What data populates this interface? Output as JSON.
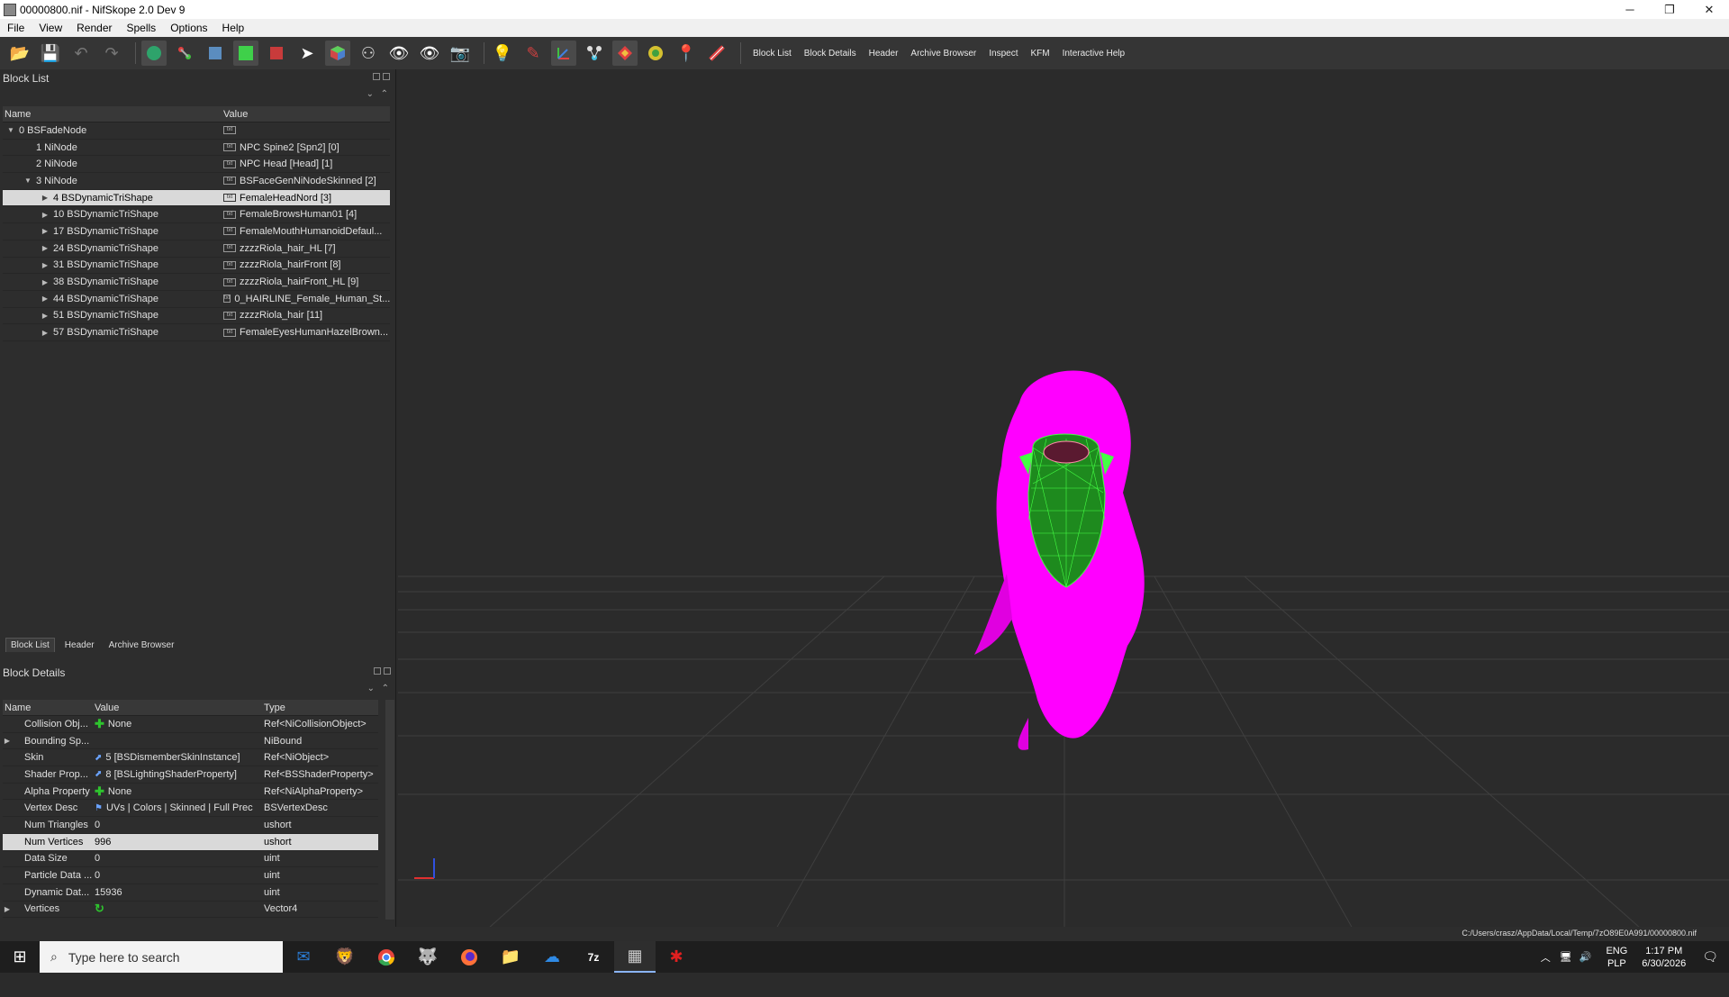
{
  "window": {
    "title": "00000800.nif - NifSkope 2.0 Dev 9"
  },
  "menu": {
    "items": [
      "File",
      "View",
      "Render",
      "Spells",
      "Options",
      "Help"
    ]
  },
  "toolbar": {
    "text_buttons": [
      "Block List",
      "Block Details",
      "Header",
      "Archive Browser",
      "Inspect",
      "KFM",
      "Interactive Help"
    ]
  },
  "block_list": {
    "title": "Block List",
    "columns": [
      "Name",
      "Value"
    ],
    "rows": [
      {
        "name": "0 BSFadeNode",
        "value": "",
        "indent": 0,
        "arrow": "▼"
      },
      {
        "name": "1 NiNode",
        "value": "NPC Spine2 [Spn2] [0]",
        "indent": 1,
        "arrow": ""
      },
      {
        "name": "2 NiNode",
        "value": "NPC Head [Head] [1]",
        "indent": 1,
        "arrow": ""
      },
      {
        "name": "3 NiNode",
        "value": "BSFaceGenNiNodeSkinned [2]",
        "indent": 1,
        "arrow": "▼"
      },
      {
        "name": "4 BSDynamicTriShape",
        "value": "FemaleHeadNord [3]",
        "indent": 2,
        "arrow": "▶",
        "selected": true
      },
      {
        "name": "10 BSDynamicTriShape",
        "value": "FemaleBrowsHuman01 [4]",
        "indent": 2,
        "arrow": "▶"
      },
      {
        "name": "17 BSDynamicTriShape",
        "value": "FemaleMouthHumanoidDefaul...",
        "indent": 2,
        "arrow": "▶"
      },
      {
        "name": "24 BSDynamicTriShape",
        "value": "zzzzRiola_hair_HL [7]",
        "indent": 2,
        "arrow": "▶"
      },
      {
        "name": "31 BSDynamicTriShape",
        "value": "zzzzRiola_hairFront [8]",
        "indent": 2,
        "arrow": "▶"
      },
      {
        "name": "38 BSDynamicTriShape",
        "value": "zzzzRiola_hairFront_HL [9]",
        "indent": 2,
        "arrow": "▶"
      },
      {
        "name": "44 BSDynamicTriShape",
        "value": "0_HAIRLINE_Female_Human_St...",
        "indent": 2,
        "arrow": "▶"
      },
      {
        "name": "51 BSDynamicTriShape",
        "value": "zzzzRiola_hair [11]",
        "indent": 2,
        "arrow": "▶"
      },
      {
        "name": "57 BSDynamicTriShape",
        "value": "FemaleEyesHumanHazelBrown...",
        "indent": 2,
        "arrow": "▶"
      }
    ]
  },
  "tabs": [
    "Block List",
    "Header",
    "Archive Browser"
  ],
  "block_details": {
    "title": "Block Details",
    "columns": [
      "Name",
      "Value",
      "Type"
    ],
    "rows": [
      {
        "name": "Collision Obj...",
        "value": "None",
        "type": "Ref<NiCollisionObject>",
        "marker": "plus",
        "arrow": ""
      },
      {
        "name": "Bounding Sp...",
        "value": "",
        "type": "NiBound",
        "marker": "",
        "arrow": "▶"
      },
      {
        "name": "Skin",
        "value": "5 [BSDismemberSkinInstance]",
        "type": "Ref<NiObject>",
        "marker": "link",
        "arrow": ""
      },
      {
        "name": "Shader Prop...",
        "value": "8 [BSLightingShaderProperty]",
        "type": "Ref<BSShaderProperty>",
        "marker": "link",
        "arrow": ""
      },
      {
        "name": "Alpha Property",
        "value": "None",
        "type": "Ref<NiAlphaProperty>",
        "marker": "plus",
        "arrow": ""
      },
      {
        "name": "Vertex Desc",
        "value": "UVs | Colors | Skinned | Full Prec",
        "type": "BSVertexDesc",
        "marker": "flag",
        "arrow": ""
      },
      {
        "name": "Num Triangles",
        "value": "0",
        "type": "ushort",
        "marker": "",
        "arrow": ""
      },
      {
        "name": "Num Vertices",
        "value": "996",
        "type": "ushort",
        "marker": "",
        "arrow": "",
        "selected": true
      },
      {
        "name": "Data Size",
        "value": "0",
        "type": "uint",
        "marker": "",
        "arrow": ""
      },
      {
        "name": "Particle Data ...",
        "value": "0",
        "type": "uint",
        "marker": "",
        "arrow": ""
      },
      {
        "name": "Dynamic Dat...",
        "value": "15936",
        "type": "uint",
        "marker": "",
        "arrow": ""
      },
      {
        "name": "Vertices",
        "value": "",
        "type": "Vector4",
        "marker": "cycle",
        "arrow": "▶"
      }
    ]
  },
  "status": {
    "path": "C:/Users/crasz/AppData/Local/Temp/7zO89E0A991/00000800.nif"
  },
  "taskbar": {
    "search_placeholder": "Type here to search",
    "lang_top": "ENG",
    "lang_bottom": "PLP",
    "time": "1:17 PM",
    "date": "6/30/2026"
  },
  "colors": {
    "hair": "#ff00ff",
    "wireframe": "#33ff33",
    "selection": "#d9d9d9",
    "background": "#2b2b2b"
  }
}
